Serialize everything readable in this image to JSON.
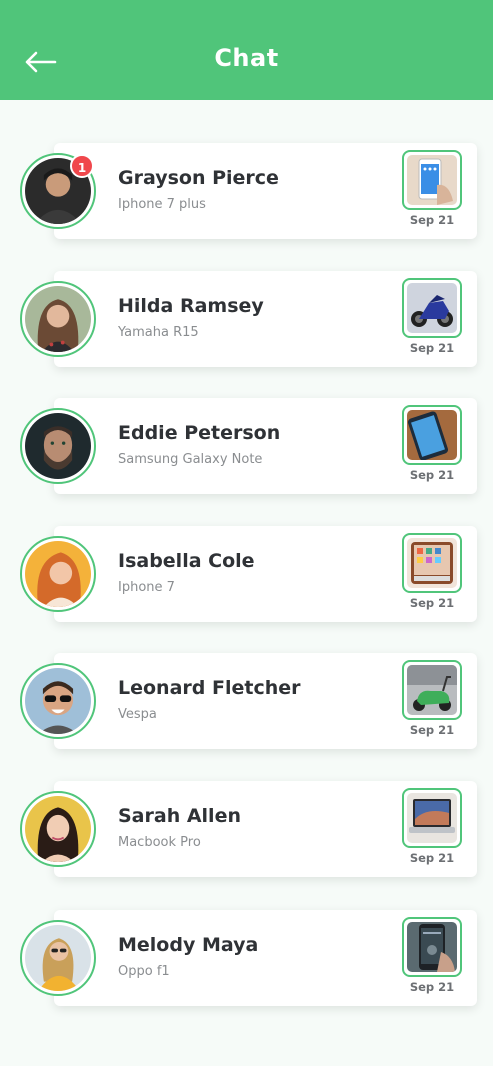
{
  "header": {
    "title": "Chat",
    "back_icon": "arrow-left-icon"
  },
  "colors": {
    "accent": "#50c57a",
    "badge": "#f0474c",
    "background": "#f6fbf8"
  },
  "chats": [
    {
      "name": "Grayson Pierce",
      "product": "Iphone 7 plus",
      "date": "Sep 21",
      "unread": "1",
      "thumb": "iphone-icon",
      "avatar": "person-avatar"
    },
    {
      "name": "Hilda Ramsey",
      "product": "Yamaha R15",
      "date": "Sep 21",
      "unread": "",
      "thumb": "motorbike-icon",
      "avatar": "person-avatar"
    },
    {
      "name": "Eddie Peterson",
      "product": "Samsung Galaxy Note",
      "date": "Sep 21",
      "unread": "",
      "thumb": "phone-icon",
      "avatar": "person-avatar"
    },
    {
      "name": "Isabella Cole",
      "product": "Iphone 7",
      "date": "Sep 21",
      "unread": "",
      "thumb": "iphone-icon",
      "avatar": "person-avatar"
    },
    {
      "name": "Leonard Fletcher",
      "product": "Vespa",
      "date": "Sep 21",
      "unread": "",
      "thumb": "scooter-icon",
      "avatar": "person-avatar"
    },
    {
      "name": "Sarah Allen",
      "product": "Macbook Pro",
      "date": "Sep 21",
      "unread": "",
      "thumb": "laptop-icon",
      "avatar": "person-avatar"
    },
    {
      "name": "Melody Maya",
      "product": "Oppo f1",
      "date": "Sep 21",
      "unread": "",
      "thumb": "phone-icon",
      "avatar": "person-avatar"
    }
  ]
}
